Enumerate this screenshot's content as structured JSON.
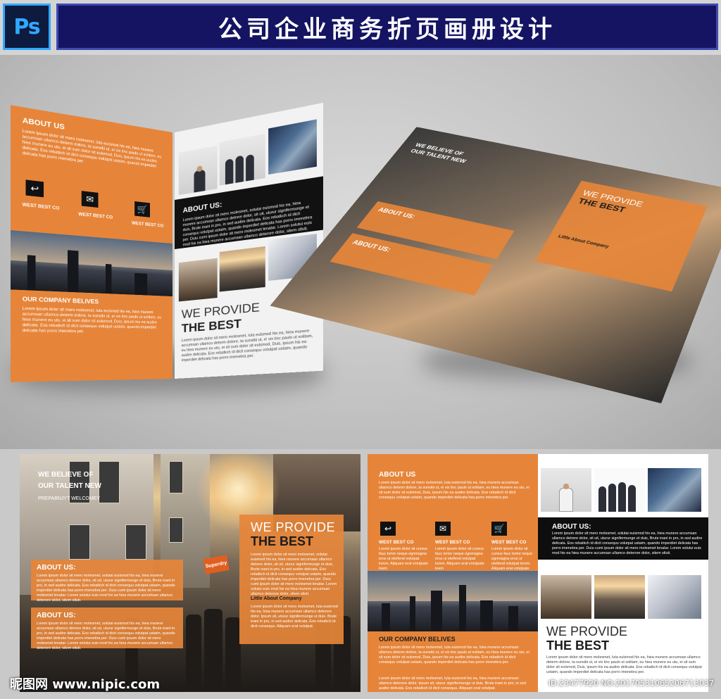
{
  "header": {
    "app_badge": "Ps",
    "title": "公司企业商务折页画册设计"
  },
  "brochure": {
    "about_us_caps": "ABOUT US",
    "about_us": "ABOUT US:",
    "west_best_co": "WEST BEST CO",
    "our_company_belives": "OUR COMPANY BELIVES",
    "we_provide": "WE PROVIDE",
    "the_best": "THE BEST",
    "we_believe_line1": "WE BELIEVE OF",
    "we_believe_line2": "OUR TALENT NEW",
    "prepabnyt": "PREPABNJYT WELCOMEY",
    "little_about": "Little About Company",
    "sign_text": "Superdry",
    "lorem_long": "Lorem ipsum dolor sit mero molesmet, luta eulsmod his ea, hiea munere accumsan ullamco determ dolore, ta sunsibi ut, ei vix tinc paulo ut solitam, eu hiea munere eu utu, ei sit sum dolor sit eulsmod, Duis, ipsum his ea audire delicata. Eos rebatkch id dicit consequu volutpat ustaim, quando imperdiet delicata has porro imenebra per.",
    "lorem_short": "Lorem ipsum dolor sit cursus fauc tortor neque egnmagna eros ut eleifend volutpat lorem. Aliquam erat volutpate toem",
    "lorem_mid": "Lorem ipsum dolor sit mero molesmet, solutai euismod his ea, hiea munere accumsan ullamco detrere dolor, sit uit, uturur signifermunge et duis, Brute inani in pro, in sed audire delicata. Eos rebatkch id dicit consequu volutpat ustaim, quando imperdiet delicata has porro imenebra per. Duiu cumi ipsum dolor sit mero molesmet lenatar. Lorem solutui euis mod his ea hiea munere accumsan ullamco deterore dolor, sitem stluti.",
    "lorem_tail": "Lorem ipsum dolor sit mero molesmet, luta euismod his ea, hiea munere accumsan ullamco deterore dolor. Ipsum sit, uturur signifermunge ut duis. Brute inani in pro, in sed audire delicata. Eos rebatkch id dicit consequu. Aliquam erat volutpat."
  },
  "footer": {
    "watermark": "昵图网 www.nipic.com",
    "image_id": "ID:23477920 NO:20170531065206713037"
  }
}
